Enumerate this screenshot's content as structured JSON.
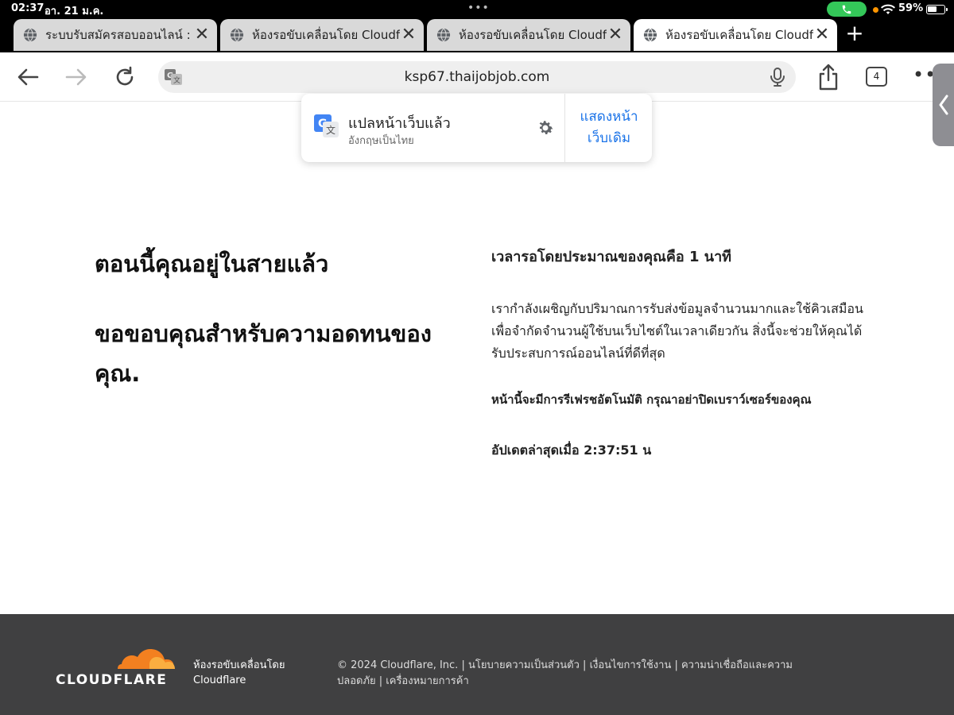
{
  "status_bar": {
    "time": "02:37",
    "date": "อา. 21 ม.ค.",
    "battery_percent_label": "59%",
    "battery_level": 0.59,
    "call_color": "#34c759",
    "indicator_color": "#ff9500"
  },
  "tabs": [
    {
      "title": "ระบบรับสมัครสอบออนไลน์ :",
      "active": false
    },
    {
      "title": "ห้องรอขับเคลื่อนโดย Cloudf",
      "active": false
    },
    {
      "title": "ห้องรอขับเคลื่อนโดย Cloudf",
      "active": false
    },
    {
      "title": "ห้องรอขับเคลื่อนโดย Cloudf",
      "active": true
    }
  ],
  "toolbar": {
    "url": "ksp67.thaijobjob.com",
    "tab_count": "4"
  },
  "translate_popup": {
    "title": "แปลหน้าเว็บแล้ว",
    "subtitle": "อังกฤษเป็นไทย",
    "show_original": "แสดงหน้าเว็บเดิม",
    "accent": "#1a73e8"
  },
  "main": {
    "heading_1": "ตอนนี้คุณอยู่ในสายแล้ว",
    "heading_2": "ขอขอบคุณสำหรับความอดทนของคุณ.",
    "wait_time": "เวลารอโดยประมาณของคุณคือ 1 นาที",
    "paragraph": "เรากำลังเผชิญกับปริมาณการรับส่งข้อมูลจำนวนมากและใช้คิวเสมือนเพื่อจำกัดจำนวนผู้ใช้บนเว็บไซต์ในเวลาเดียวกัน สิ่งนี้จะช่วยให้คุณได้รับประสบการณ์ออนไลน์ที่ดีที่สุด",
    "refresh_note": "หน้านี้จะมีการรีเฟรชอัตโนมัติ กรุณาอย่าปิดเบราว์เซอร์ของคุณ",
    "last_updated": "อัปเดตล่าสุดเมื่อ 2:37:51 น"
  },
  "footer": {
    "brand": "CLOUDFLARE",
    "brand_color": "#f38020",
    "powered_by_line1": "ห้องรอขับเคลื่อนโดย",
    "powered_by_line2": "Cloudflare",
    "links_text": "© 2024 Cloudflare, Inc. | นโยบายความเป็นส่วนตัว | เงื่อนไขการใช้งาน | ความน่าเชื่อถือและความปลอดภัย | เครื่องหมายการค้า",
    "background": "#404041"
  }
}
